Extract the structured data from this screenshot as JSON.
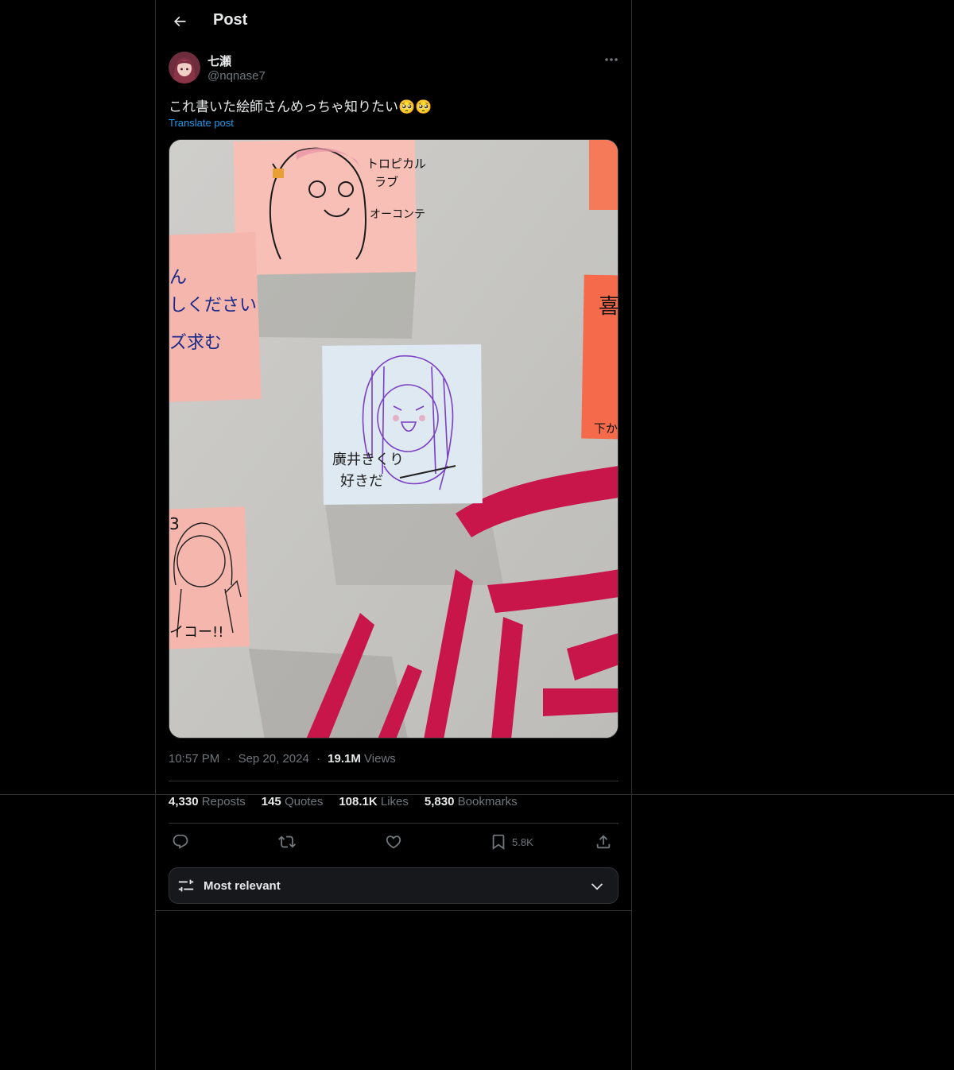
{
  "header": {
    "title": "Post"
  },
  "author": {
    "display_name": "七瀬",
    "handle": "@nqnase7"
  },
  "post": {
    "text": "これ書いた絵師さんめっちゃ知りたい🥺🥺",
    "translate_label": "Translate post"
  },
  "media": {
    "kind": "photo",
    "description_icons": [
      "sticky-note-drawings"
    ],
    "notes": {
      "top_note_text_1": "トロピカル",
      "top_note_text_2": "ラブ",
      "top_note_text_3": "オーコンテ",
      "left_note_text_1": "ん",
      "left_note_text_2": "しください",
      "left_note_text_3": "ズ求む",
      "center_note_text_1": "廣井きくり",
      "center_note_text_2": "好きだ",
      "bottom_left_note_text": "イコー!!",
      "bottom_left_corner": "3",
      "right_note_text_1": "喜",
      "right_note_text_2": "下か"
    }
  },
  "meta": {
    "time": "10:57 PM",
    "dot": "·",
    "date": "Sep 20, 2024",
    "views_count": "19.1M",
    "views_label": "Views"
  },
  "stats": {
    "reposts_count": "4,330",
    "reposts_label": "Reposts",
    "quotes_count": "145",
    "quotes_label": "Quotes",
    "likes_count": "108.1K",
    "likes_label": "Likes",
    "bookmarks_count": "5,830",
    "bookmarks_label": "Bookmarks"
  },
  "actions": {
    "bookmark_count": "5.8K"
  },
  "sort": {
    "label": "Most relevant"
  },
  "colors": {
    "background": "#000000",
    "accent": "#1d9bf0",
    "muted": "#71767b",
    "border": "#2f3336"
  }
}
